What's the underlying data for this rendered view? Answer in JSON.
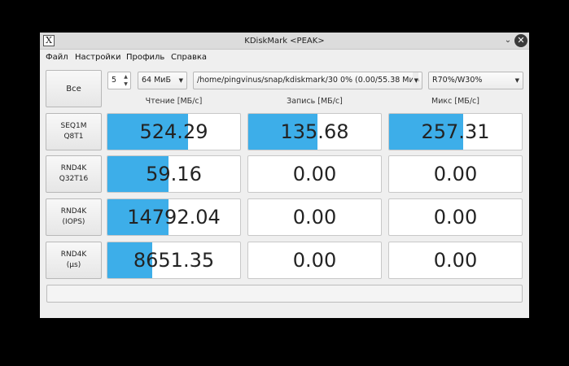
{
  "window": {
    "title": "KDiskMark <PEAK>",
    "app_icon_glyph": "X",
    "chevron_glyph": "⌄",
    "close_glyph": "✕"
  },
  "menu": [
    "Файл",
    "Настройки",
    "Профиль",
    "Справка"
  ],
  "controls": {
    "all_button": "Все",
    "runs": "5",
    "size": "64 МиБ",
    "path": "/home/pingvinus/snap/kdiskmark/30 0% (0.00/55.38 МиБ",
    "mix": "R70%/W30%"
  },
  "headers": {
    "read": "Чтение [МБ/с]",
    "write": "Запись [МБ/с]",
    "mix": "Микс [МБ/с]"
  },
  "rows": [
    {
      "line1": "SEQ1M",
      "line2": "Q8T1",
      "read": "524.29",
      "write": "135.68",
      "mix": "257.31",
      "read_fill": 0.61,
      "write_fill": 0.52,
      "mix_fill": 0.56
    },
    {
      "line1": "RND4K",
      "line2": "Q32T16",
      "read": "59.16",
      "write": "0.00",
      "mix": "0.00",
      "read_fill": 0.46,
      "write_fill": 0,
      "mix_fill": 0
    },
    {
      "line1": "RND4K",
      "line2": "(IOPS)",
      "read": "14792.04",
      "write": "0.00",
      "mix": "0.00",
      "read_fill": 0.46,
      "write_fill": 0,
      "mix_fill": 0
    },
    {
      "line1": "RND4K",
      "line2": "(µs)",
      "read": "8651.35",
      "write": "0.00",
      "mix": "0.00",
      "read_fill": 0.34,
      "write_fill": 0,
      "mix_fill": 0
    }
  ],
  "status_text": "",
  "colors": {
    "fill": "#3daee9",
    "background": "#000000",
    "window": "#efefef"
  }
}
